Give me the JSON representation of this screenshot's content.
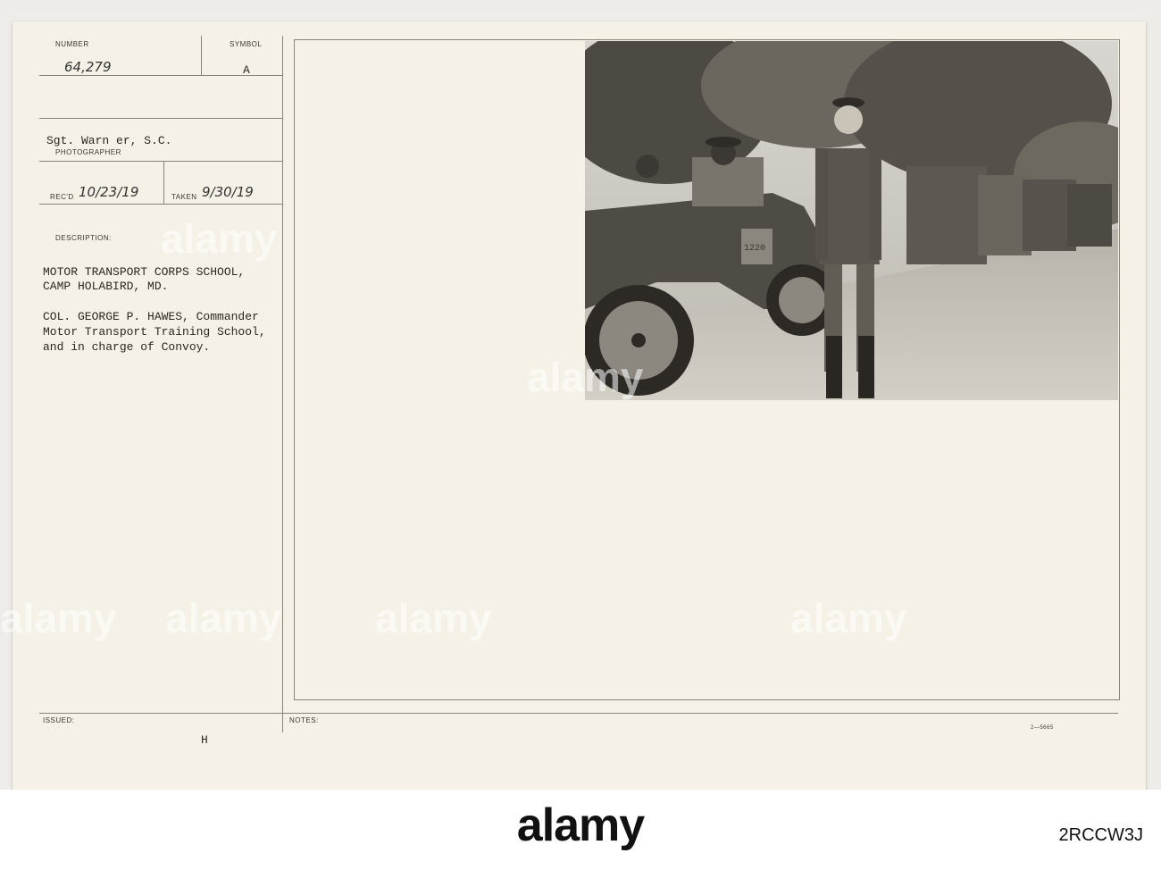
{
  "record": {
    "number_label": "NUMBER",
    "number_value": "64,279",
    "symbol_label": "SYMBOL",
    "symbol_value": "A",
    "photographer_value": "Sgt. Warn er, S.C.",
    "photographer_label": "PHOTOGRAPHER",
    "recd_label": "REC'D",
    "recd_value": "10/23/19",
    "taken_label": "TAKEN",
    "taken_value": "9/30/19",
    "description_label": "DESCRIPTION:",
    "description_line1": "MOTOR TRANSPORT CORPS SCHOOL,",
    "description_line2": "CAMP HOLABIRD, MD.",
    "caption_line1": "COL. GEORGE P. HAWES, Commander",
    "caption_line2": "Motor Transport Training School,",
    "caption_line3": "and in charge of Convoy.",
    "issued_label": "ISSUED:",
    "issued_value": "H",
    "notes_label": "NOTES:",
    "form_code": "2—5665"
  },
  "photo": {
    "plate_number": "1220"
  },
  "watermark": {
    "brand": "alamy",
    "image_id": "2RCCW3J",
    "colors": {
      "bar": "#ffffff",
      "card": "#f5f1e6",
      "ink": "#2a2722"
    }
  }
}
